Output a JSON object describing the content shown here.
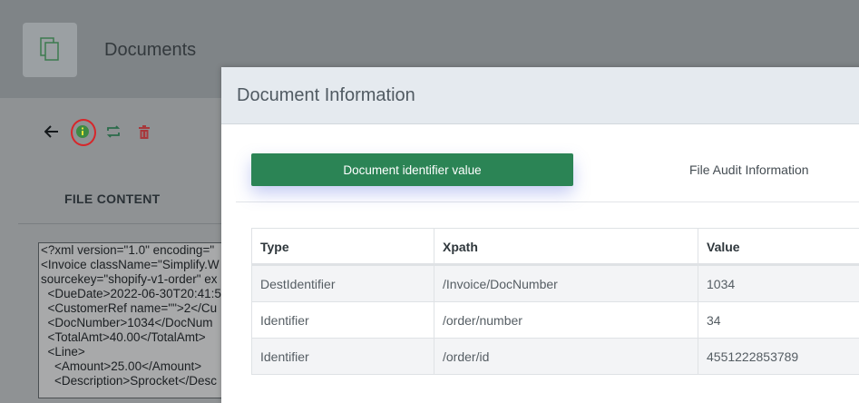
{
  "background": {
    "app_title": "Documents",
    "tab_label": "FILE CONTENT",
    "xml_lines": [
      "<?xml version=\"1.0\" encoding=\"",
      "<Invoice className=\"Simplify.W",
      "sourcekey=\"shopify-v1-order\" ex",
      "  <DueDate>2022-06-30T20:41:5",
      "  <CustomerRef name=\"\">2</Cu",
      "  <DocNumber>1034</DocNum",
      "  <TotalAmt>40.00</TotalAmt>",
      "  <Line>",
      "    <Amount>25.00</Amount>",
      "    <Description>Sprocket</Desc"
    ],
    "toolbar_icons": [
      "back-arrow-icon",
      "info-icon",
      "repeat-icon",
      "trash-icon"
    ]
  },
  "modal": {
    "title": "Document Information",
    "tabs": [
      {
        "label": "Document identifier value",
        "active": true
      },
      {
        "label": "File Audit Information",
        "active": false
      }
    ],
    "table": {
      "columns": [
        "Type",
        "Xpath",
        "Value"
      ],
      "rows": [
        {
          "type": "DestIdentifier",
          "xpath": "/Invoice/DocNumber",
          "value": "1034"
        },
        {
          "type": "Identifier",
          "xpath": "/order/number",
          "value": "34"
        },
        {
          "type": "Identifier",
          "xpath": "/order/id",
          "value": "4551222853789"
        }
      ]
    }
  },
  "colors": {
    "accent_green": "#2b8455",
    "delete_red": "#a8383b",
    "highlight_ring": "#d7262a"
  }
}
